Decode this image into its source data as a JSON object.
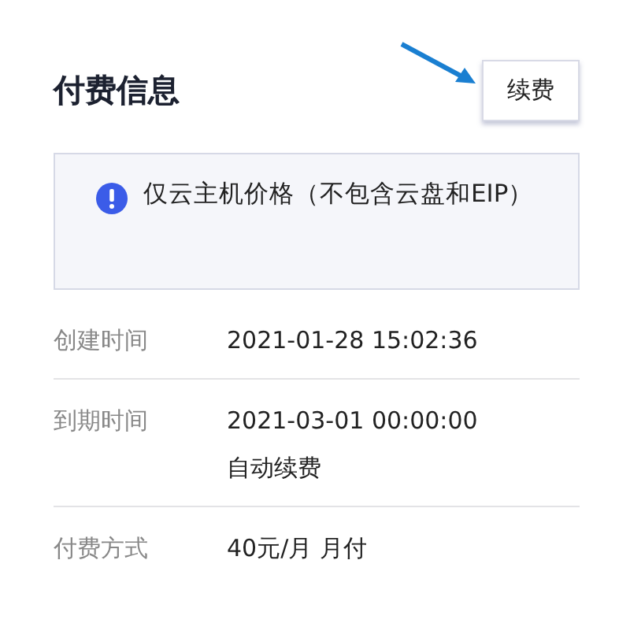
{
  "header": {
    "title": "付费信息",
    "button": "续费"
  },
  "notice": {
    "text": "仅云主机价格（不包含云盘和EIP）"
  },
  "rows": [
    {
      "label": "创建时间",
      "values": [
        "2021-01-28 15:02:36"
      ]
    },
    {
      "label": "到期时间",
      "values": [
        "2021-03-01 00:00:00",
        "自动续费"
      ]
    },
    {
      "label": "付费方式",
      "values": [
        "40元/月 月付"
      ]
    }
  ]
}
